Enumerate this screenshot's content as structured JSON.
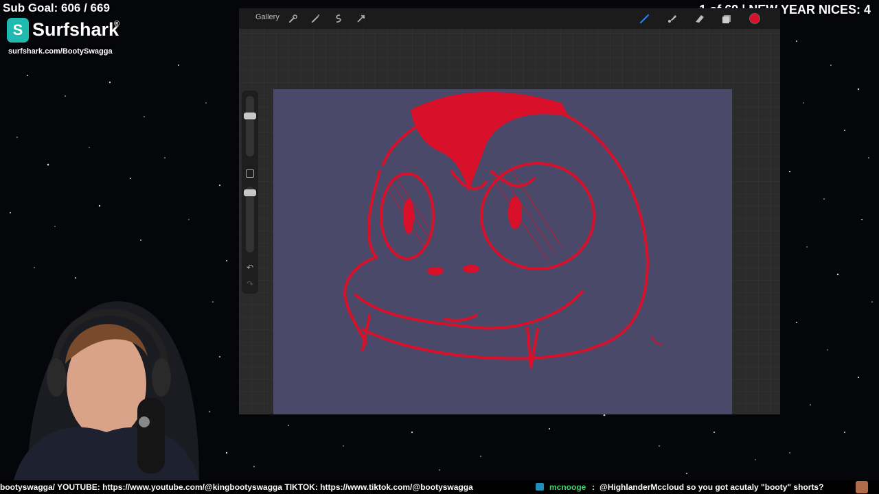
{
  "overlay": {
    "sub_goal": "Sub Goal: 606 / 669",
    "sponsor_name": "Surfshark",
    "sponsor_reg": "®",
    "sponsor_logo_letter": "S",
    "sponsor_url": "surfshark.com/BootySwagga",
    "counter": "1 of 69 | NEW YEAR NICES: 4"
  },
  "procreate": {
    "gallery_label": "Gallery",
    "left_tools": [
      "wrench-icon",
      "magic-wand-icon",
      "selection-icon",
      "transform-icon"
    ],
    "right_tools": [
      "brush-icon",
      "smudge-icon",
      "eraser-icon",
      "layers-icon",
      "color-icon"
    ],
    "active_color": "#d8102a",
    "canvas_color": "#4a4969",
    "stroke_color": "#d8102a"
  },
  "ticker": {
    "left_text": "bootyswagga/ YOUTUBE: https://www.youtube.com/@kingbootyswagga TIKTOK: https://www.tiktok.com/@bootyswagga",
    "chat_user": "mcnooge",
    "chat_sep": ":",
    "chat_message": "@HighlanderMccloud so you got acutaly \"booty\" shorts?"
  }
}
